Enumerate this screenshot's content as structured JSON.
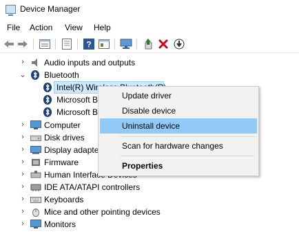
{
  "window": {
    "title": "Device Manager"
  },
  "menu": [
    "File",
    "Action",
    "View",
    "Help"
  ],
  "toolbar": {
    "icons": [
      "back-arrow-icon",
      "forward-arrow-icon",
      "properties-icon",
      "document-icon",
      "help-icon",
      "console-icon",
      "monitor-icon",
      "update-driver-icon",
      "uninstall-x-icon",
      "download-arrow-icon"
    ],
    "accent_red": "#d0021b",
    "accent_green": "#2e7d32"
  },
  "tree": {
    "items": [
      {
        "label": "Audio inputs and outputs",
        "expanded": false,
        "icon": "speaker-icon"
      },
      {
        "label": "Bluetooth",
        "expanded": true,
        "icon": "bluetooth-icon"
      },
      {
        "label": "Intel(R) Wireless Bluetooth(R)",
        "child": true,
        "selected": true,
        "icon": "bluetooth-icon"
      },
      {
        "label": "Microsoft Bluetooth Enumerator",
        "child": true,
        "icon": "bluetooth-icon"
      },
      {
        "label": "Microsoft Bluetooth LE Enumerator",
        "child": true,
        "icon": "bluetooth-icon"
      },
      {
        "label": "Computer",
        "expanded": false,
        "icon": "computer-icon"
      },
      {
        "label": "Disk drives",
        "expanded": false,
        "icon": "disk-drive-icon"
      },
      {
        "label": "Display adapters",
        "expanded": false,
        "icon": "display-adapter-icon"
      },
      {
        "label": "Firmware",
        "expanded": false,
        "icon": "firmware-icon"
      },
      {
        "label": "Human Interface Devices",
        "expanded": false,
        "icon": "hid-icon"
      },
      {
        "label": "IDE ATA/ATAPI controllers",
        "expanded": false,
        "icon": "ide-controller-icon"
      },
      {
        "label": "Keyboards",
        "expanded": false,
        "icon": "keyboard-icon"
      },
      {
        "label": "Mice and other pointing devices",
        "expanded": false,
        "icon": "mouse-icon"
      },
      {
        "label": "Monitors",
        "expanded": false,
        "icon": "monitor-icon"
      }
    ],
    "selection_color": "#cde8ff"
  },
  "context_menu": {
    "items": [
      {
        "label": "Update driver"
      },
      {
        "label": "Disable device"
      },
      {
        "label": "Uninstall device",
        "highlighted": true
      },
      {
        "label": "Scan for hardware changes"
      },
      {
        "label": "Properties",
        "bold": true
      }
    ],
    "highlight_color": "#91c9f7"
  }
}
